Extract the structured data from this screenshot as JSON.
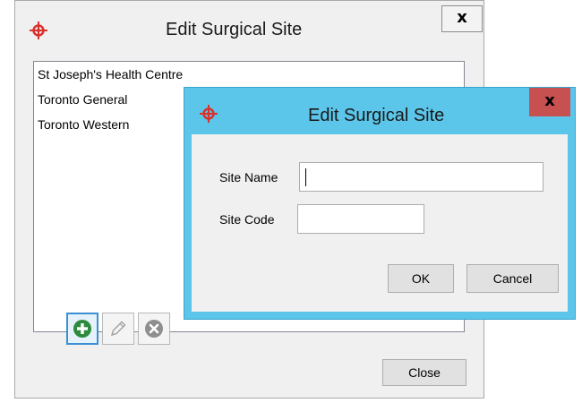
{
  "outer_dialog": {
    "title": "Edit Surgical Site",
    "close_glyph": "x",
    "sites": [
      "St Joseph's Health Centre",
      "Toronto General",
      "Toronto Western"
    ],
    "toolbar": {
      "add_icon": "plus-circle-icon",
      "edit_icon": "pencil-icon",
      "delete_icon": "x-circle-icon"
    },
    "close_button_label": "Close"
  },
  "inner_dialog": {
    "title": "Edit Surgical Site",
    "close_glyph": "x",
    "site_name_label": "Site Name",
    "site_name_value": "",
    "site_code_label": "Site Code",
    "site_code_value": "",
    "ok_label": "OK",
    "cancel_label": "Cancel"
  },
  "colors": {
    "app_icon": "#d9322c",
    "inner_title_bar": "#5bc6ea",
    "inner_close": "#c75050",
    "add_button": "#2e8b3d"
  }
}
